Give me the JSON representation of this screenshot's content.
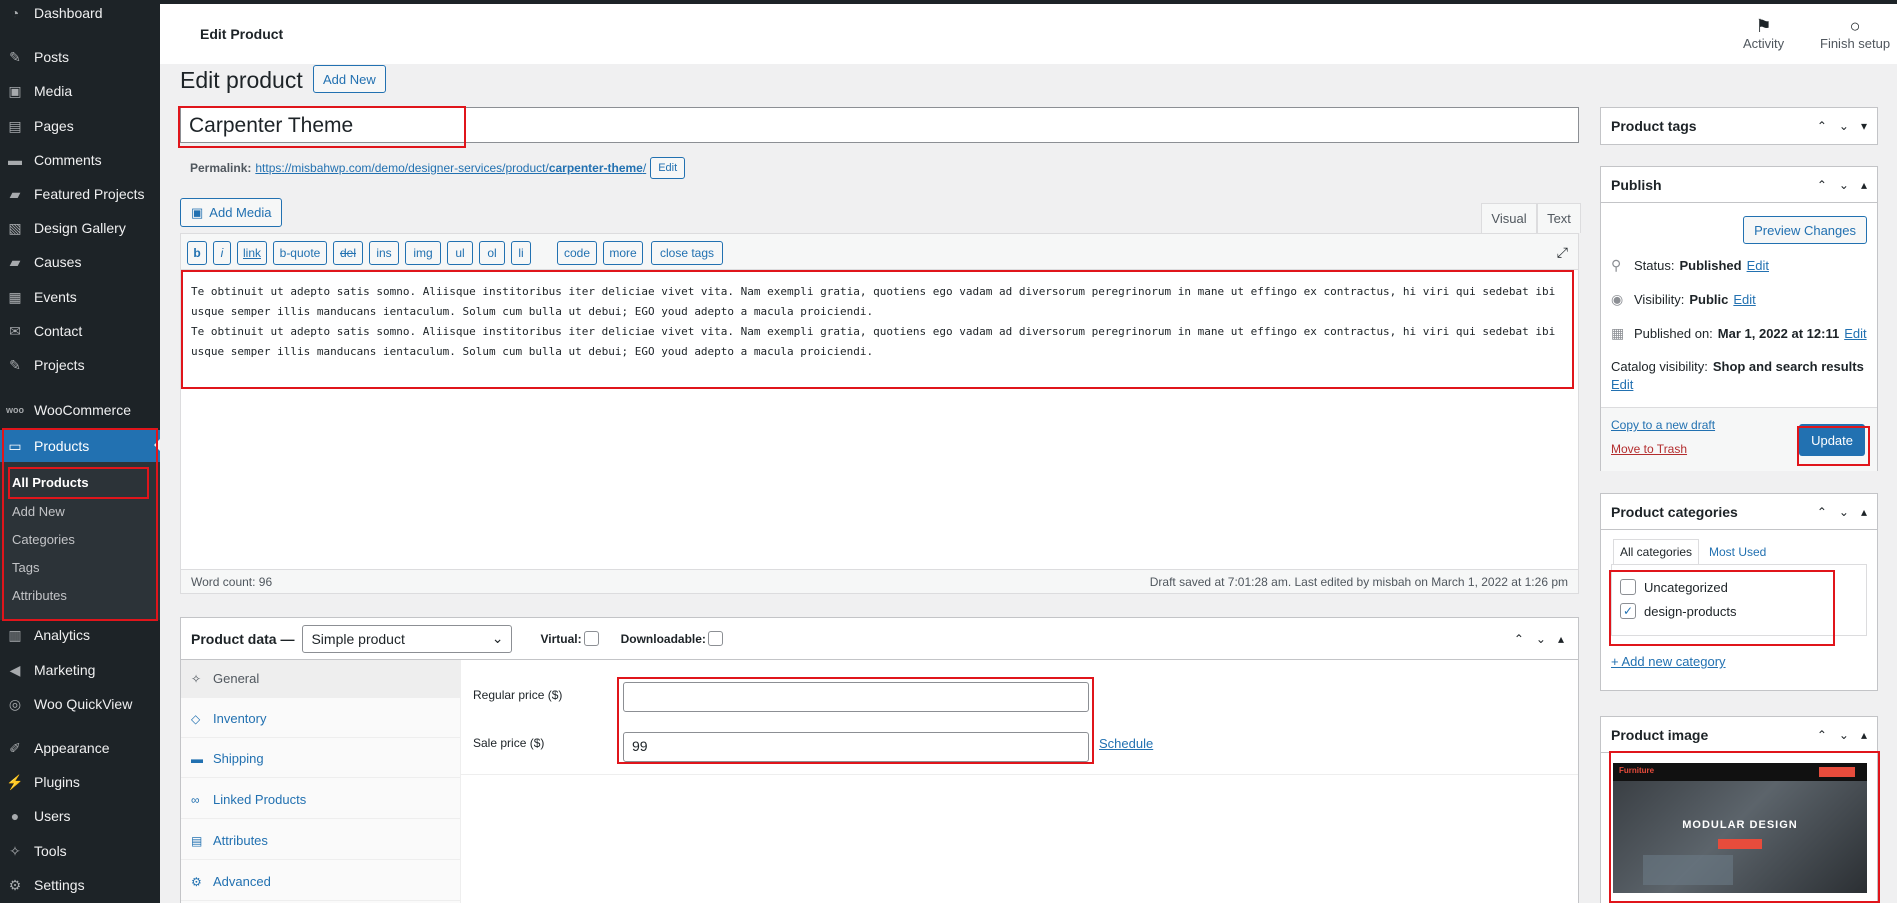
{
  "sidebar": {
    "items": [
      {
        "label": "Dashboard",
        "icon": "dashboard-icon"
      },
      {
        "label": "Posts",
        "icon": "pin-icon"
      },
      {
        "label": "Media",
        "icon": "media-icon"
      },
      {
        "label": "Pages",
        "icon": "page-icon"
      },
      {
        "label": "Comments",
        "icon": "comment-icon"
      },
      {
        "label": "Featured Projects",
        "icon": "folder-icon"
      },
      {
        "label": "Design Gallery",
        "icon": "gallery-icon"
      },
      {
        "label": "Causes",
        "icon": "folder-icon"
      },
      {
        "label": "Events",
        "icon": "calendar-icon"
      },
      {
        "label": "Contact",
        "icon": "mail-icon"
      },
      {
        "label": "Projects",
        "icon": "edit-icon"
      },
      {
        "label": "WooCommerce",
        "icon": "woo-icon"
      },
      {
        "label": "Products",
        "icon": "archive-icon"
      },
      {
        "label": "Analytics",
        "icon": "chart-icon"
      },
      {
        "label": "Marketing",
        "icon": "megaphone-icon"
      },
      {
        "label": "Woo QuickView",
        "icon": "eye-icon"
      },
      {
        "label": "Appearance",
        "icon": "brush-icon"
      },
      {
        "label": "Plugins",
        "icon": "plug-icon"
      },
      {
        "label": "Users",
        "icon": "user-icon"
      },
      {
        "label": "Tools",
        "icon": "wrench-icon"
      },
      {
        "label": "Settings",
        "icon": "settings-icon"
      }
    ],
    "submenu": [
      "All Products",
      "Add New",
      "Categories",
      "Tags",
      "Attributes"
    ]
  },
  "topbar": {
    "title": "Edit Product",
    "activity": "Activity",
    "finish_setup": "Finish setup"
  },
  "main": {
    "heading": "Edit product",
    "add_new": "Add New",
    "product_title": "Carpenter Theme",
    "permalink_label": "Permalink:",
    "permalink_base": "https://misbahwp.com/demo/designer-services/product/",
    "permalink_slug": "carpenter-theme",
    "permalink_trail": "/",
    "permalink_edit": "Edit",
    "add_media": "Add Media",
    "tab_visual": "Visual",
    "tab_text": "Text",
    "quicktags": [
      "b",
      "i",
      "link",
      "b-quote",
      "del",
      "ins",
      "img",
      "ul",
      "ol",
      "li",
      "code",
      "more",
      "close tags"
    ],
    "content": "Te obtinuit ut adepto satis somno. Aliisque institoribus iter deliciae vivet vita. Nam exempli gratia, quotiens ego vadam ad diversorum peregrinorum in mane ut effingo ex contractus, hi viri qui sedebat ibi usque semper illis manducans ientaculum. Solum cum bulla ut debui; EGO youd adepto a macula proiciendi.\nTe obtinuit ut adepto satis somno. Aliisque institoribus iter deliciae vivet vita. Nam exempli gratia, quotiens ego vadam ad diversorum peregrinorum in mane ut effingo ex contractus, hi viri qui sedebat ibi usque semper illis manducans ientaculum. Solum cum bulla ut debui; EGO youd adepto a macula proiciendi.",
    "word_count": "Word count: 96",
    "draft_saved": "Draft saved at 7:01:28 am. Last edited by misbah on March 1, 2022 at 1:26 pm"
  },
  "product_data": {
    "label": "Product data —",
    "type": "Simple product",
    "virtual": "Virtual:",
    "downloadable": "Downloadable:",
    "tabs": [
      "General",
      "Inventory",
      "Shipping",
      "Linked Products",
      "Attributes",
      "Advanced"
    ],
    "regular_price_label": "Regular price ($)",
    "regular_price": "",
    "sale_price_label": "Sale price ($)",
    "sale_price": "99",
    "schedule": "Schedule"
  },
  "right": {
    "tags_title": "Product tags",
    "publish": {
      "title": "Publish",
      "preview": "Preview Changes",
      "status_label": "Status:",
      "status": "Published",
      "visibility_label": "Visibility:",
      "visibility": "Public",
      "published_label": "Published on:",
      "published": "Mar 1, 2022 at 12:11",
      "catalog_label": "Catalog visibility:",
      "catalog": "Shop and search results",
      "edit": "Edit",
      "copy_draft": "Copy to a new draft",
      "trash": "Move to Trash",
      "update": "Update"
    },
    "categories": {
      "title": "Product categories",
      "tab_all": "All categories",
      "tab_used": "Most Used",
      "items": [
        {
          "label": "Uncategorized",
          "checked": false
        },
        {
          "label": "design-products",
          "checked": true
        }
      ],
      "add_new": "+ Add new category"
    },
    "image": {
      "title": "Product image",
      "thumb_brand": "Furniture",
      "thumb_headline": "MODULAR DESIGN"
    }
  }
}
